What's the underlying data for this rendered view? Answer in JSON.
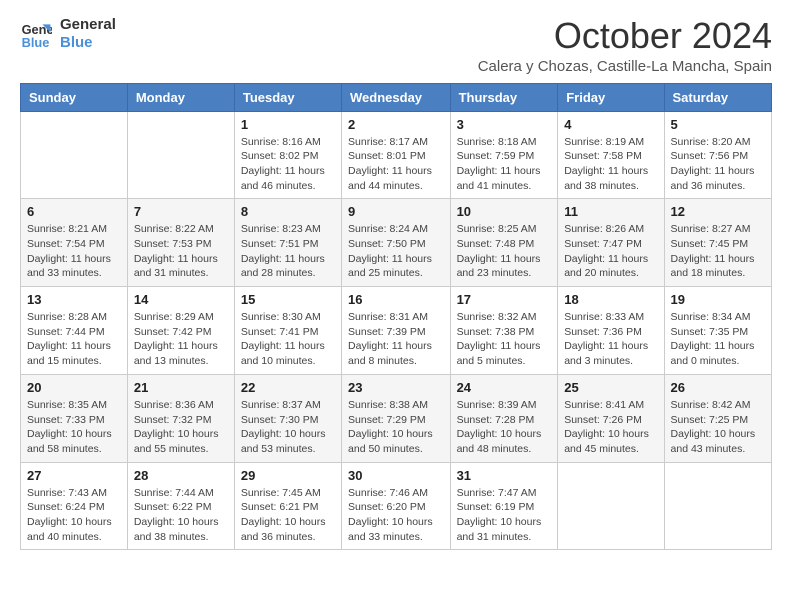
{
  "header": {
    "logo_line1": "General",
    "logo_line2": "Blue",
    "month_title": "October 2024",
    "subtitle": "Calera y Chozas, Castille-La Mancha, Spain"
  },
  "weekdays": [
    "Sunday",
    "Monday",
    "Tuesday",
    "Wednesday",
    "Thursday",
    "Friday",
    "Saturday"
  ],
  "weeks": [
    [
      {
        "day": "",
        "info": ""
      },
      {
        "day": "",
        "info": ""
      },
      {
        "day": "1",
        "info": "Sunrise: 8:16 AM\nSunset: 8:02 PM\nDaylight: 11 hours and 46 minutes."
      },
      {
        "day": "2",
        "info": "Sunrise: 8:17 AM\nSunset: 8:01 PM\nDaylight: 11 hours and 44 minutes."
      },
      {
        "day": "3",
        "info": "Sunrise: 8:18 AM\nSunset: 7:59 PM\nDaylight: 11 hours and 41 minutes."
      },
      {
        "day": "4",
        "info": "Sunrise: 8:19 AM\nSunset: 7:58 PM\nDaylight: 11 hours and 38 minutes."
      },
      {
        "day": "5",
        "info": "Sunrise: 8:20 AM\nSunset: 7:56 PM\nDaylight: 11 hours and 36 minutes."
      }
    ],
    [
      {
        "day": "6",
        "info": "Sunrise: 8:21 AM\nSunset: 7:54 PM\nDaylight: 11 hours and 33 minutes."
      },
      {
        "day": "7",
        "info": "Sunrise: 8:22 AM\nSunset: 7:53 PM\nDaylight: 11 hours and 31 minutes."
      },
      {
        "day": "8",
        "info": "Sunrise: 8:23 AM\nSunset: 7:51 PM\nDaylight: 11 hours and 28 minutes."
      },
      {
        "day": "9",
        "info": "Sunrise: 8:24 AM\nSunset: 7:50 PM\nDaylight: 11 hours and 25 minutes."
      },
      {
        "day": "10",
        "info": "Sunrise: 8:25 AM\nSunset: 7:48 PM\nDaylight: 11 hours and 23 minutes."
      },
      {
        "day": "11",
        "info": "Sunrise: 8:26 AM\nSunset: 7:47 PM\nDaylight: 11 hours and 20 minutes."
      },
      {
        "day": "12",
        "info": "Sunrise: 8:27 AM\nSunset: 7:45 PM\nDaylight: 11 hours and 18 minutes."
      }
    ],
    [
      {
        "day": "13",
        "info": "Sunrise: 8:28 AM\nSunset: 7:44 PM\nDaylight: 11 hours and 15 minutes."
      },
      {
        "day": "14",
        "info": "Sunrise: 8:29 AM\nSunset: 7:42 PM\nDaylight: 11 hours and 13 minutes."
      },
      {
        "day": "15",
        "info": "Sunrise: 8:30 AM\nSunset: 7:41 PM\nDaylight: 11 hours and 10 minutes."
      },
      {
        "day": "16",
        "info": "Sunrise: 8:31 AM\nSunset: 7:39 PM\nDaylight: 11 hours and 8 minutes."
      },
      {
        "day": "17",
        "info": "Sunrise: 8:32 AM\nSunset: 7:38 PM\nDaylight: 11 hours and 5 minutes."
      },
      {
        "day": "18",
        "info": "Sunrise: 8:33 AM\nSunset: 7:36 PM\nDaylight: 11 hours and 3 minutes."
      },
      {
        "day": "19",
        "info": "Sunrise: 8:34 AM\nSunset: 7:35 PM\nDaylight: 11 hours and 0 minutes."
      }
    ],
    [
      {
        "day": "20",
        "info": "Sunrise: 8:35 AM\nSunset: 7:33 PM\nDaylight: 10 hours and 58 minutes."
      },
      {
        "day": "21",
        "info": "Sunrise: 8:36 AM\nSunset: 7:32 PM\nDaylight: 10 hours and 55 minutes."
      },
      {
        "day": "22",
        "info": "Sunrise: 8:37 AM\nSunset: 7:30 PM\nDaylight: 10 hours and 53 minutes."
      },
      {
        "day": "23",
        "info": "Sunrise: 8:38 AM\nSunset: 7:29 PM\nDaylight: 10 hours and 50 minutes."
      },
      {
        "day": "24",
        "info": "Sunrise: 8:39 AM\nSunset: 7:28 PM\nDaylight: 10 hours and 48 minutes."
      },
      {
        "day": "25",
        "info": "Sunrise: 8:41 AM\nSunset: 7:26 PM\nDaylight: 10 hours and 45 minutes."
      },
      {
        "day": "26",
        "info": "Sunrise: 8:42 AM\nSunset: 7:25 PM\nDaylight: 10 hours and 43 minutes."
      }
    ],
    [
      {
        "day": "27",
        "info": "Sunrise: 7:43 AM\nSunset: 6:24 PM\nDaylight: 10 hours and 40 minutes."
      },
      {
        "day": "28",
        "info": "Sunrise: 7:44 AM\nSunset: 6:22 PM\nDaylight: 10 hours and 38 minutes."
      },
      {
        "day": "29",
        "info": "Sunrise: 7:45 AM\nSunset: 6:21 PM\nDaylight: 10 hours and 36 minutes."
      },
      {
        "day": "30",
        "info": "Sunrise: 7:46 AM\nSunset: 6:20 PM\nDaylight: 10 hours and 33 minutes."
      },
      {
        "day": "31",
        "info": "Sunrise: 7:47 AM\nSunset: 6:19 PM\nDaylight: 10 hours and 31 minutes."
      },
      {
        "day": "",
        "info": ""
      },
      {
        "day": "",
        "info": ""
      }
    ]
  ]
}
